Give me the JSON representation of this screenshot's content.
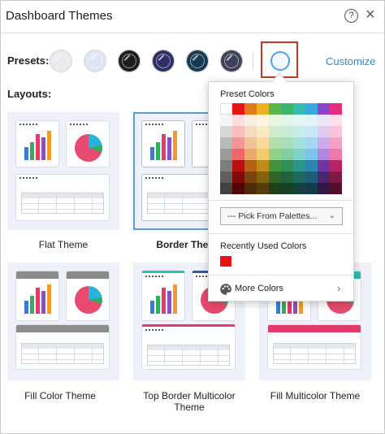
{
  "dialog": {
    "title": "Dashboard Themes",
    "help_icon": "question-circle-icon",
    "close_icon": "close-icon",
    "help_glyph": "?",
    "close_glyph": "×"
  },
  "presets": {
    "label": "Presets:",
    "swatches": [
      {
        "name": "light-gray",
        "color": "#e9e9ee"
      },
      {
        "name": "pale-blue",
        "color": "#dde5f5"
      },
      {
        "name": "black",
        "color": "#1d1d1f"
      },
      {
        "name": "navy-purple",
        "color": "#2c2f63"
      },
      {
        "name": "teal-navy",
        "color": "#173a55"
      },
      {
        "name": "slate",
        "color": "#3f4256"
      }
    ],
    "selected_color_ring": "#4aa3e8",
    "customize_label": "Customize"
  },
  "layouts": {
    "label": "Layouts:",
    "themes": [
      {
        "label": "Flat Theme",
        "selected": false
      },
      {
        "label": "Border Theme",
        "selected": true
      },
      {
        "label": "Fill Color Theme",
        "selected": false
      },
      {
        "label": "Top Border Multicolor Theme",
        "selected": false
      },
      {
        "label": "Fill Multicolor Theme",
        "selected": false
      }
    ]
  },
  "color_popup": {
    "preset_label": "Preset Colors",
    "base_row": [
      "#ffffff",
      "#e81416",
      "#e07b1b",
      "#efb01d",
      "#59b848",
      "#3fb46b",
      "#35bdb0",
      "#3aa6dd",
      "#8b44cc",
      "#e52d7e"
    ],
    "palette_select_label": "--- Pick From Palettes...",
    "recent_label": "Recently Used Colors",
    "recent_colors": [
      "#e81416"
    ],
    "more_colors_label": "More Colors"
  }
}
